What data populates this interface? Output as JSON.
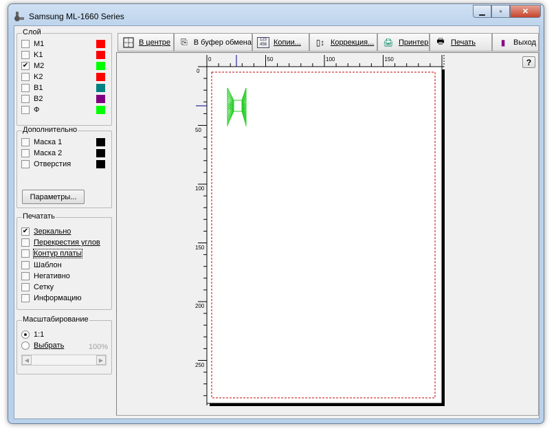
{
  "window": {
    "title": "Samsung ML-1660 Series"
  },
  "layers": {
    "title": "Слой",
    "items": [
      {
        "label": "M1",
        "checked": false,
        "color": "#ff0000"
      },
      {
        "label": "K1",
        "checked": false,
        "color": "#ff0000"
      },
      {
        "label": "M2",
        "checked": true,
        "color": "#00ff00"
      },
      {
        "label": "K2",
        "checked": false,
        "color": "#ff0000"
      },
      {
        "label": "B1",
        "checked": false,
        "color": "#008080"
      },
      {
        "label": "B2",
        "checked": false,
        "color": "#800080"
      },
      {
        "label": "Ф",
        "checked": false,
        "color": "#00ff00"
      }
    ]
  },
  "extra": {
    "title": "Дополнительно",
    "items": [
      {
        "label": "Маска 1",
        "checked": false,
        "color": "#000000"
      },
      {
        "label": "Маска 2",
        "checked": false,
        "color": "#000000"
      },
      {
        "label": "Отверстия",
        "checked": false,
        "color": "#000000"
      }
    ],
    "params_button": "Параметры..."
  },
  "print": {
    "title": "Печатать",
    "items": [
      {
        "label": "Зеркально",
        "checked": true
      },
      {
        "label": "Перекрестия углов",
        "checked": false
      },
      {
        "label": "Контур платы",
        "checked": false
      },
      {
        "label": "Шаблон",
        "checked": false
      },
      {
        "label": "Негативно",
        "checked": false
      },
      {
        "label": "Сетку",
        "checked": false
      },
      {
        "label": "Информацию",
        "checked": false
      }
    ]
  },
  "scale": {
    "title": "Масштабирование",
    "option_1to1": "1:1",
    "option_choose": "Выбрать",
    "selected": "1:1",
    "percent": "100%"
  },
  "toolbar": {
    "center": "В центре",
    "clipboard": "В буфер обмена",
    "copies": "Копии...",
    "correction": "Коррекция...",
    "printer": "Принтер",
    "print": "Печать",
    "exit": "Выход"
  },
  "help_button": "?",
  "ruler": {
    "x_labels": [
      "0",
      "50",
      "100",
      "150"
    ],
    "y_labels": [
      "0",
      "50",
      "100",
      "150",
      "200",
      "250"
    ]
  }
}
